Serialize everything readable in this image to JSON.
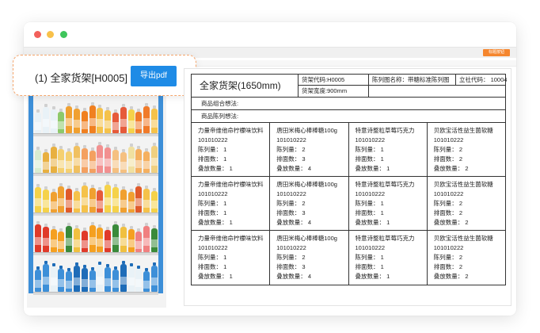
{
  "window": {
    "topbar_badge": "标题按钮"
  },
  "popup": {
    "title": "(1) 全家货架[H0005]",
    "export_label": "导出pdf"
  },
  "sheet": {
    "shelf_name": "全家货架(1650mm)",
    "shelf_code": "货架代码:H0005",
    "chart_name": "陈列图名称：带糖标准陈列图",
    "outlet_code": "立社代码： 10004",
    "shelf_width": "货架宽度:900mm",
    "combo_idea_label": "商品组合想法:",
    "display_idea_label": "商品陈列想法:",
    "rows": [
      [
        {
          "name": "力量帝维他命柠檬味饮料",
          "code": "101010222",
          "display": "陈列量： 1",
          "facing": "排面数： 1",
          "stack": "叠放数量： 1"
        },
        {
          "name": "唐田米梅心棒棒糖100g",
          "code": "101010222",
          "display": "陈列量： 2",
          "facing": "排面数： 3",
          "stack": "叠放数量： 4"
        },
        {
          "name": "特意诗整粒草莓巧克力",
          "code": "101010222",
          "display": "陈列量： 1",
          "facing": "排面数： 1",
          "stack": "叠放数量： 1"
        },
        {
          "name": "贝欧宝活性益生菌软糖",
          "code": "101010222",
          "display": "陈列量： 2",
          "facing": "排面数： 2",
          "stack": "叠放数量： 2"
        }
      ],
      [
        {
          "name": "力量帝维他命柠檬味饮料",
          "code": "101010222",
          "display": "陈列量： 1",
          "facing": "排面数： 1",
          "stack": "叠放数量： 1"
        },
        {
          "name": "唐田米梅心棒棒糖100g",
          "code": "101010222",
          "display": "陈列量： 2",
          "facing": "排面数： 3",
          "stack": "叠放数量： 4"
        },
        {
          "name": "特意诗整粒草莓巧克力",
          "code": "101010222",
          "display": "陈列量： 1",
          "facing": "排面数： 1",
          "stack": "叠放数量： 1"
        },
        {
          "name": "贝欧宝活性益生菌软糖",
          "code": "101010222",
          "display": "陈列量： 2",
          "facing": "排面数： 2",
          "stack": "叠放数量： 2"
        }
      ],
      [
        {
          "name": "力量帝维他命柠檬味饮料",
          "code": "101010222",
          "display": "陈列量： 1",
          "facing": "排面数： 1",
          "stack": "叠放数量： 1"
        },
        {
          "name": "唐田米梅心棒棒糖100g",
          "code": "101010222",
          "display": "陈列量： 2",
          "facing": "排面数： 3",
          "stack": "叠放数量： 4"
        },
        {
          "name": "特意诗整粒草莓巧克力",
          "code": "101010222",
          "display": "陈列量： 1",
          "facing": "排面数： 1",
          "stack": "叠放数量： 1"
        },
        {
          "name": "贝欧宝活性益生菌软糖",
          "code": "101010222",
          "display": "陈列量： 2",
          "facing": "排面数： 2",
          "stack": "叠放数量： 2"
        }
      ]
    ]
  },
  "shelf_image": {
    "rows": [
      [
        "#e9f2f7",
        "#e9f2f7",
        "#e9f2f7",
        "#8dc96a",
        "#f0a030",
        "#f0a030",
        "#f08020",
        "#f08020",
        "#f5c24a",
        "#f5c24a",
        "#e65a3a",
        "#e65a3a",
        "#f5d24a",
        "#f07a2a",
        "#f07a2a",
        "#f5c24a"
      ],
      [
        "#d8ecd0",
        "#e8b040",
        "#e8b040",
        "#f5d070",
        "#f5d070",
        "#f0c060",
        "#f4a060",
        "#f4a060",
        "#f29090",
        "#f29090",
        "#f5c080",
        "#f5c080",
        "#f0e0a0",
        "#f5b060",
        "#f5b060",
        "#f0d080"
      ],
      [
        "#f5d24a",
        "#f5d24a",
        "#f0a030",
        "#f0a030",
        "#e05a2a",
        "#f5c24a",
        "#f5c24a",
        "#f0a030",
        "#e65a3a",
        "#f5d24a",
        "#f5d24a",
        "#f0a030",
        "#f0a030",
        "#e05a2a",
        "#f5c24a",
        "#f5d24a"
      ],
      [
        "#e03a2a",
        "#e03a2a",
        "#f5a020",
        "#f5a020",
        "#3a8a3a",
        "#f0c040",
        "#e03a2a",
        "#f5a020",
        "#f5a020",
        "#e03a2a",
        "#3a8a3a",
        "#f0c040",
        "#f5a020",
        "#f08080",
        "#f08080",
        "#3a8a3a"
      ],
      [
        "#3d8fd8",
        "#3d8fd8",
        "#e9f2f7",
        "#3d8fd8",
        "#3d8fd8",
        "#1e6cb8",
        "#1e6cb8",
        "#3d8fd8",
        "#e9f2f7",
        "#3d8fd8",
        "#3d8fd8",
        "#1e6cb8",
        "#e9f2f7",
        "#e9f2f7",
        "#3d8fd8",
        "#3d8fd8"
      ]
    ]
  }
}
